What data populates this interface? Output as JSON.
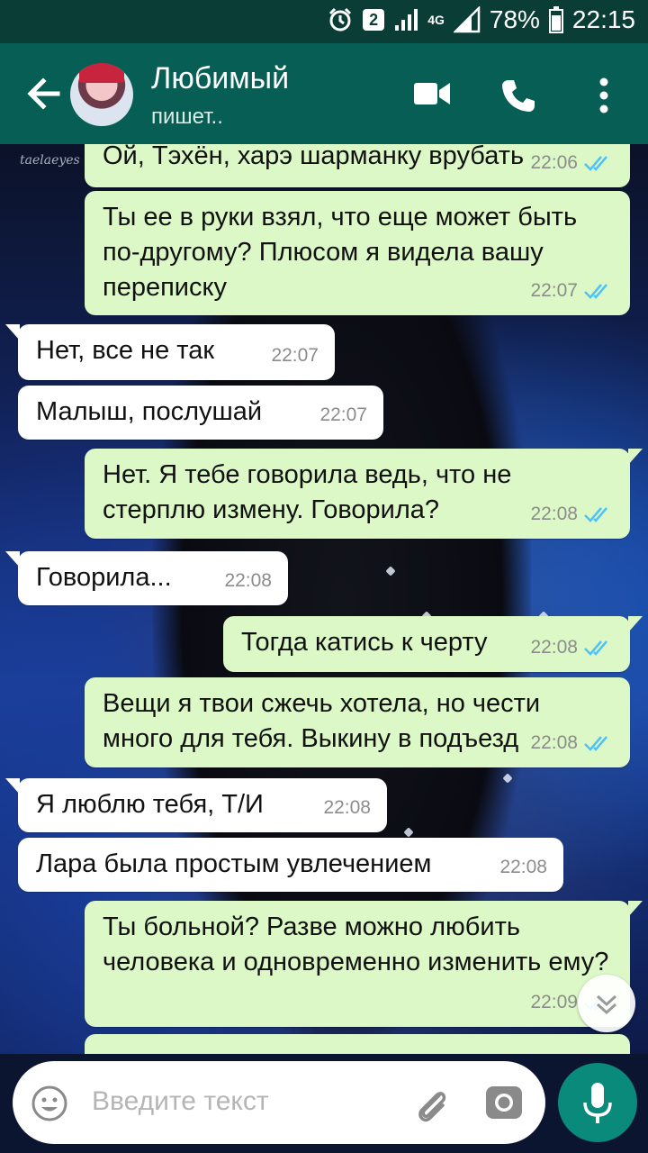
{
  "status_bar": {
    "badge": "2",
    "network": "4G",
    "battery": "78%",
    "time": "22:15"
  },
  "header": {
    "contact_name": "Любимый",
    "contact_status": "пишет.."
  },
  "wallpaper": {
    "watermark": "taelaeyes"
  },
  "messages": [
    {
      "dir": "out",
      "text": "Ой, Тэхён, харэ шарманку врубать",
      "time": "22:06",
      "read": true
    },
    {
      "dir": "out",
      "text": "Ты ее в руки взял, что еще может быть по-другому? Плюсом я видела вашу переписку",
      "time": "22:07",
      "read": true
    },
    {
      "dir": "in",
      "text": "Нет, все не так",
      "time": "22:07"
    },
    {
      "dir": "in",
      "text": "Малыш, послушай",
      "time": "22:07"
    },
    {
      "dir": "out",
      "text": "Нет. Я тебе говорила ведь, что не стерплю измену. Говорила?",
      "time": "22:08",
      "read": true
    },
    {
      "dir": "in",
      "text": "Говорила...",
      "time": "22:08"
    },
    {
      "dir": "out",
      "text": "Тогда катись к черту",
      "time": "22:08",
      "read": true
    },
    {
      "dir": "out",
      "text": "Вещи я твои сжечь хотела, но чести много для тебя. Выкину в подъезд",
      "time": "22:08",
      "read": true
    },
    {
      "dir": "in",
      "text": "Я люблю тебя, Т/И",
      "time": "22:08"
    },
    {
      "dir": "in",
      "text": "Лара была простым увлечением",
      "time": "22:08"
    },
    {
      "dir": "out",
      "text": "Ты больной? Разве можно любить человека и одновременно изменить ему?",
      "time": "22:09",
      "read": true
    }
  ],
  "input": {
    "placeholder": "Введите текст"
  },
  "colors": {
    "header": "#075e54",
    "outgoing_bubble": "#dcf8c6",
    "incoming_bubble": "#ffffff",
    "read_ticks": "#4fc3f7",
    "mic_button": "#0a8a7a"
  }
}
